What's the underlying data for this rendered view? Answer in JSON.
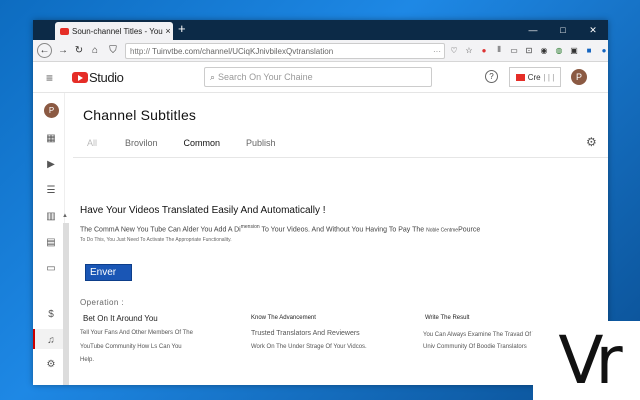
{
  "browser": {
    "tab_title": "Soun-channel Titles - You",
    "tab_close": "×",
    "new_tab": "+",
    "url_prefix": "http://",
    "url": "Tuinvtbe.com/channel/UCiqKJnivbilexQvtranslation",
    "window_controls": [
      "—",
      "□",
      "✕"
    ]
  },
  "yt": {
    "logo_text": "Studio",
    "search_placeholder": "Search On Your Chaine",
    "help": "?",
    "create_label": "Cre"
  },
  "avatar_initial": "P",
  "page": {
    "title": "Channel Subtitles",
    "tabs": [
      "All",
      "Brovilon",
      "Common",
      "Publish"
    ],
    "active_tab": "Common",
    "heading": "Have Your Videos Translated Easily And Automatically !",
    "body_line1_a": "The Comm",
    "body_line1_b": "A New You Tube Can Alder You Add A Di",
    "body_line1_sup": "mension",
    "body_line1_c": "To Your Videos. And Without You Having To Pay The",
    "body_line1_small": "Noble Cent",
    "body_line1_d": "me",
    "body_line1_e": "Pource",
    "body_line2": "To Do This, You Just Need To Activate The Appropriate Functionality.",
    "enable_button": "Enver",
    "operation_label": "Operation :",
    "columns": [
      {
        "header": "Bet On It Around You",
        "lines": [
          "Tell Your Fans And Other Members Of The",
          "YouTube Community How Ls Can You",
          "Help."
        ]
      },
      {
        "header": "Know The Advancement",
        "lines": [
          "Trusted Translators And Reviewers",
          "Work On The Under Strage Of Your Vidcos."
        ]
      },
      {
        "header": "Write The Result",
        "lines": [
          "You Can Always Examine The Travad Of The",
          "Univ Community Of Boodie Translators"
        ]
      }
    ]
  },
  "overlay_logo": "Vr"
}
